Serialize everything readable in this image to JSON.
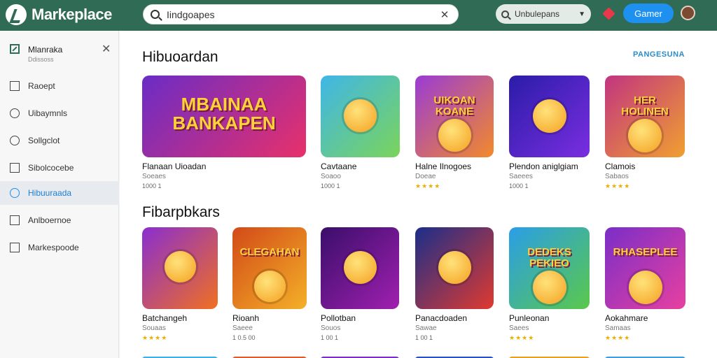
{
  "app": {
    "title": "Markeplace"
  },
  "search": {
    "value": "Iindgoapes"
  },
  "filter": {
    "value": "Unbulepans"
  },
  "header": {
    "cta_label": "Gamer"
  },
  "sidebar": {
    "header_title": "Mlanraka",
    "header_subtitle": "Ddissoss",
    "items": [
      {
        "label": "Raoept",
        "icon": "bookmark-icon"
      },
      {
        "label": "Uibaymnls",
        "icon": "compass-icon"
      },
      {
        "label": "Sollgclot",
        "icon": "circle-icon"
      },
      {
        "label": "Sibolcocebe",
        "icon": "tablet-icon"
      },
      {
        "label": "Hibuuraada",
        "icon": "globe-icon",
        "active": true
      },
      {
        "label": "Anlboernoe",
        "icon": "gear-icon"
      },
      {
        "label": "Markespoode",
        "icon": "calendar-icon"
      }
    ]
  },
  "sections": [
    {
      "title": "Hibuoardan",
      "see_all": "PANGESUNA",
      "cards": [
        {
          "name": "Flanaan Uioadan",
          "category": "Soeaes",
          "meta": "1000 1",
          "banner": "MBAINAA BANKAPEN",
          "bg": [
            "#6a2cc6",
            "#e8306a"
          ]
        },
        {
          "name": "Cavtaane",
          "category": "Soaoo",
          "meta": "1000 1",
          "bg": [
            "#3fb6e8",
            "#7bd45a"
          ]
        },
        {
          "name": "Halne Ilnogoes",
          "category": "Doeae",
          "stars": "★★★★",
          "banner": "UIKOAN KOANE",
          "bg": [
            "#9a3bd6",
            "#f28a2a"
          ]
        },
        {
          "name": "Plendon aniglgiam",
          "category": "Saeees",
          "meta": "1000 1",
          "bg": [
            "#2a1ca8",
            "#7a2ee0"
          ]
        },
        {
          "name": "Clamois",
          "category": "Sabaos",
          "stars": "★★★★",
          "banner": "HER HOLINEN",
          "bg": [
            "#c23480",
            "#f0a030"
          ]
        }
      ]
    },
    {
      "title": "Fibarpbkars",
      "cards": [
        {
          "name": "Batchangeh",
          "category": "Souaas",
          "stars": "★★★★",
          "bg": [
            "#8a2ed0",
            "#f07020"
          ]
        },
        {
          "name": "Rioanh",
          "category": "Saeee",
          "meta": "1 0.5 00",
          "banner": "CLEGAHAN",
          "bg": [
            "#d24a18",
            "#f4b028"
          ]
        },
        {
          "name": "Pollotban",
          "category": "Souos",
          "meta": "1 00 1",
          "bg": [
            "#3a0e6a",
            "#a020b0"
          ]
        },
        {
          "name": "Panacdoaden",
          "category": "Sawae",
          "meta": "1 00 1",
          "bg": [
            "#1a2e8a",
            "#e03a30"
          ]
        },
        {
          "name": "Punleonan",
          "category": "Saees",
          "stars": "★★★★",
          "banner": "DEDEKS PEKIEO",
          "bg": [
            "#2a9ee8",
            "#5ac84a"
          ]
        },
        {
          "name": "Aokahmare",
          "category": "Samaas",
          "stars": "★★★★",
          "banner": "RHASEPLEE",
          "bg": [
            "#7a2ec8",
            "#e840a0"
          ]
        }
      ]
    }
  ],
  "colors": {
    "topbar": "#2f6b55",
    "accent": "#1e90f0",
    "notif": "#e8384a"
  }
}
